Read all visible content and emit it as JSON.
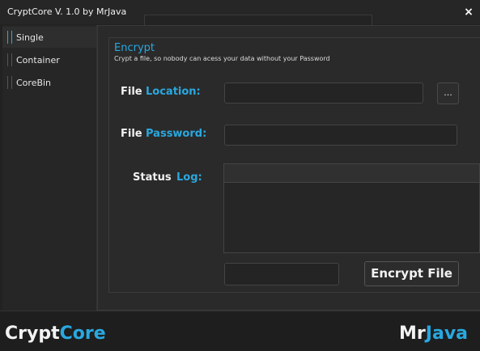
{
  "window": {
    "title": "CryptCore V. 1.0 by MrJava",
    "close_glyph": "×"
  },
  "sidebar": {
    "items": [
      {
        "label": "Single",
        "active": true
      },
      {
        "label": "Container",
        "active": false
      },
      {
        "label": "CoreBin",
        "active": false
      }
    ]
  },
  "encrypt_panel": {
    "title": "Encrypt",
    "subtitle": "Crypt a file, so nobody can acess your data without your Password",
    "file_location": {
      "label_white": "File",
      "label_blue": "Location:",
      "value": ""
    },
    "browse_label": "...",
    "file_password": {
      "label_white": "File",
      "label_blue": "Password:",
      "value": ""
    },
    "status_log": {
      "label_white": "Status",
      "label_blue": "Log:",
      "entries": []
    },
    "progress_value": "",
    "encrypt_button": "Encrypt File"
  },
  "footer": {
    "left_brand": {
      "part1": "Crypt",
      "part2": "Core"
    },
    "right_brand": {
      "part1": "Mr",
      "part2": "Java"
    }
  },
  "colors": {
    "accent": "#29a8e0",
    "background": "#222222",
    "text": "#f2f2f2"
  }
}
